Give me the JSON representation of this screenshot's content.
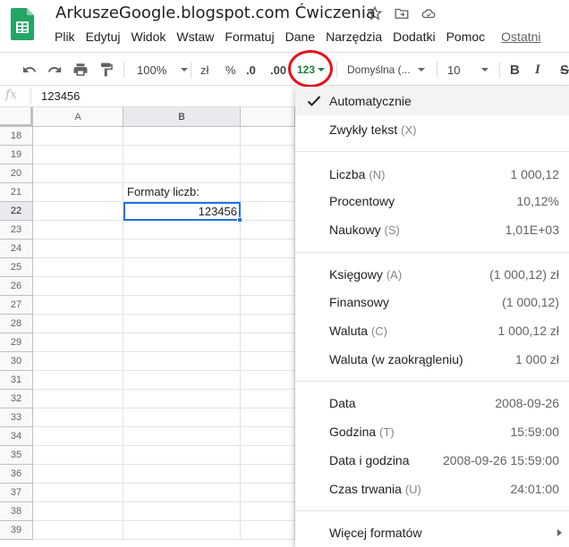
{
  "app": {
    "title": "ArkuszeGoogle.blogspot.com Ćwiczenia",
    "icons": [
      "star-icon",
      "move-to-folder-icon",
      "cloud-saved-icon"
    ]
  },
  "menubar": [
    "Plik",
    "Edytuj",
    "Widok",
    "Wstaw",
    "Formatuj",
    "Dane",
    "Narzędzia",
    "Dodatki",
    "Pomoc"
  ],
  "last_edit": "Ostatni",
  "toolbar": {
    "zoom": "100%",
    "currency": "zł",
    "percent": "%",
    "decrease_decimals": ".0",
    "increase_decimals": ".00",
    "more_formats": "123",
    "font": "Domyślna (...",
    "font_size": "10",
    "bold": "B",
    "italic": "I",
    "strikethrough": "S"
  },
  "formula_bar": {
    "label": "fx",
    "value": "123456"
  },
  "columns": [
    "A",
    "B"
  ],
  "rows": [
    "18",
    "19",
    "20",
    "21",
    "22",
    "23",
    "24",
    "25",
    "26",
    "27",
    "28",
    "29",
    "30",
    "31",
    "32",
    "33",
    "34",
    "35",
    "36",
    "37",
    "38",
    "39"
  ],
  "cells": {
    "B21": "Formaty liczb:",
    "B22": "123456"
  },
  "format_menu": {
    "automatic": "Automatycznie",
    "plain_text": {
      "label": "Zwykły tekst",
      "shortcut": "(X)"
    },
    "number": {
      "label": "Liczba",
      "shortcut": "(N)",
      "example": "1 000,12"
    },
    "percent": {
      "label": "Procentowy",
      "example": "10,12%"
    },
    "scientific": {
      "label": "Naukowy",
      "shortcut": "(S)",
      "example": "1,01E+03"
    },
    "accounting": {
      "label": "Księgowy",
      "shortcut": "(A)",
      "example": "(1 000,12) zł"
    },
    "financial": {
      "label": "Finansowy",
      "example": "(1 000,12)"
    },
    "currency": {
      "label": "Waluta",
      "shortcut": "(C)",
      "example": "1 000,12 zł"
    },
    "currency_rounded": {
      "label": "Waluta (w zaokrągleniu)",
      "example": "1 000 zł"
    },
    "date": {
      "label": "Data",
      "example": "2008-09-26"
    },
    "time": {
      "label": "Godzina",
      "shortcut": "(T)",
      "example": "15:59:00"
    },
    "datetime": {
      "label": "Data i godzina",
      "example": "2008-09-26 15:59:00"
    },
    "duration": {
      "label": "Czas trwania",
      "shortcut": "(U)",
      "example": "24:01:00"
    },
    "more_formats": "Więcej formatów"
  },
  "colors": {
    "accent": "#1a73e8",
    "sheets_green": "#188038",
    "highlight_circle": "#e8101b"
  }
}
